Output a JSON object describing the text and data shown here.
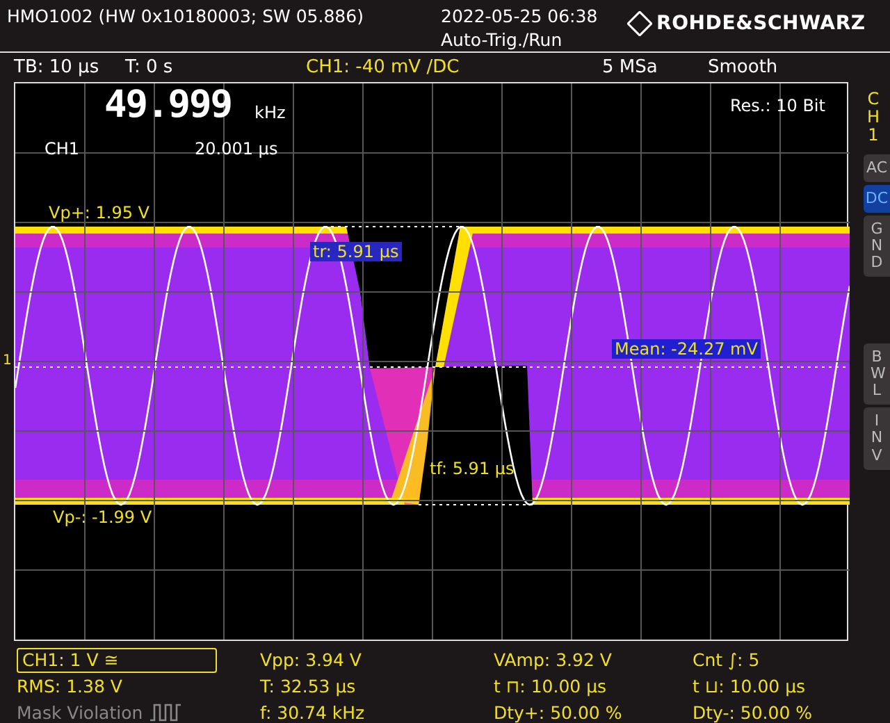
{
  "header": {
    "device": "HMO1002 (HW 0x10180003; SW 05.886)",
    "datetime": "2022-05-25 06:38",
    "trigger_status": "Auto-Trig./Run",
    "logo": "ROHDE&SCHWARZ"
  },
  "status_bar": {
    "timebase": "TB: 10 µs",
    "trigger_time": "T: 0 s",
    "channel_setting": "CH1: -40 mV /DC",
    "sample_rate": "5 MSa",
    "acquisition_mode": "Smooth"
  },
  "counter": {
    "frequency": "49.999",
    "unit": "kHz",
    "channel": "CH1",
    "period": "20.001 µs"
  },
  "resolution": "Res.: 10 Bit",
  "markers": {
    "channel_marker": "1",
    "vp_plus": "Vp+: 1.95 V",
    "rise_time": "tr: 5.91 µs",
    "mean": "Mean: -24.27 mV",
    "fall_time": "tf: 5.91 µs",
    "vp_minus": "Vp-: -1.99 V"
  },
  "side_panel": {
    "channel": "CH1",
    "buttons": [
      {
        "label": "AC",
        "selected": false
      },
      {
        "label": "DC",
        "selected": true
      },
      {
        "label": "GND",
        "selected": false
      },
      {
        "label": "BWL",
        "selected": false
      },
      {
        "label": "INV",
        "selected": false
      }
    ]
  },
  "measurements": {
    "channel_scale": "CH1: 1 V ≅",
    "cells": [
      {
        "text": "Vpp: 3.94 V",
        "disabled": false
      },
      {
        "text": "VAmp: 3.92 V",
        "disabled": false
      },
      {
        "text": "Cnt ∫: 5",
        "disabled": false
      },
      {
        "text": "RMS: 1.38 V",
        "disabled": false
      },
      {
        "text": "T: 32.53 µs",
        "disabled": false
      },
      {
        "text": "t ⊓: 10.00 µs",
        "disabled": false
      },
      {
        "text": "t ⊔: 10.00 µs",
        "disabled": false
      },
      {
        "text": "Mask Violation",
        "disabled": true
      },
      {
        "text": "f: 30.74 kHz",
        "disabled": false
      },
      {
        "text": "Dty+: 50.00 %",
        "disabled": false
      },
      {
        "text": "Dty-: 50.00 %",
        "disabled": false
      }
    ]
  }
}
